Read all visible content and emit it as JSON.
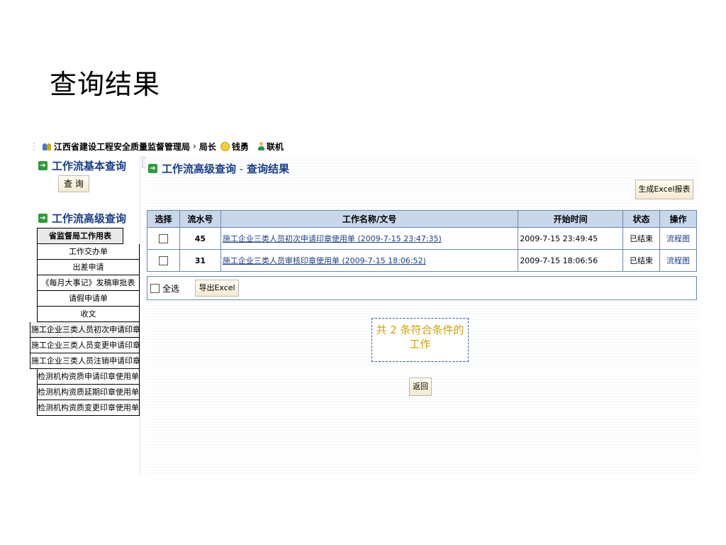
{
  "slide": {
    "title": "查询结果"
  },
  "topbar": {
    "org": "江西省建设工程安全质量监督管理局",
    "sep": "›",
    "role": "局长",
    "user": "钱勇",
    "status": "联机"
  },
  "sidebar": {
    "basic_title": "工作流基本查询",
    "query_btn": "查 询",
    "advanced_title": "工作流高级查询",
    "items": [
      "省监督局工作用表",
      "工作交办单",
      "出差申请",
      "《每月大事记》发稿审批表",
      "请假申请单",
      "收文",
      "施工企业三类人员初次申请印章使用单",
      "施工企业三类人员变更申请印章使用单",
      "施工企业三类人员注销申请印章使用单",
      "检测机构资质申请印章使用单",
      "检测机构资质延期印章使用单",
      "检测机构资质变更印章使用单"
    ]
  },
  "main": {
    "title": "工作流高级查询",
    "title_sep": " - ",
    "subtitle": "查询结果",
    "excel_report_btn": "生成Excel报表",
    "table": {
      "headers": [
        "选择",
        "流水号",
        "工作名称/文号",
        "开始时间",
        "状态",
        "操作"
      ],
      "rows": [
        {
          "serial": "45",
          "name": "施工企业三类人员初次申请印章使用单 (2009-7-15 23:47:35)",
          "start": "2009-7-15 23:49:45",
          "status": "已结束",
          "action": "流程图"
        },
        {
          "serial": "31",
          "name": "施工企业三类人员审核印章使用单 (2009-7-15 18:06:52)",
          "start": "2009-7-15 18:06:56",
          "status": "已结束",
          "action": "流程图"
        }
      ]
    },
    "select_all": "全选",
    "export_btn": "导出Excel",
    "count_text": "共 2 条符合条件的工作",
    "back_btn": "返回"
  }
}
